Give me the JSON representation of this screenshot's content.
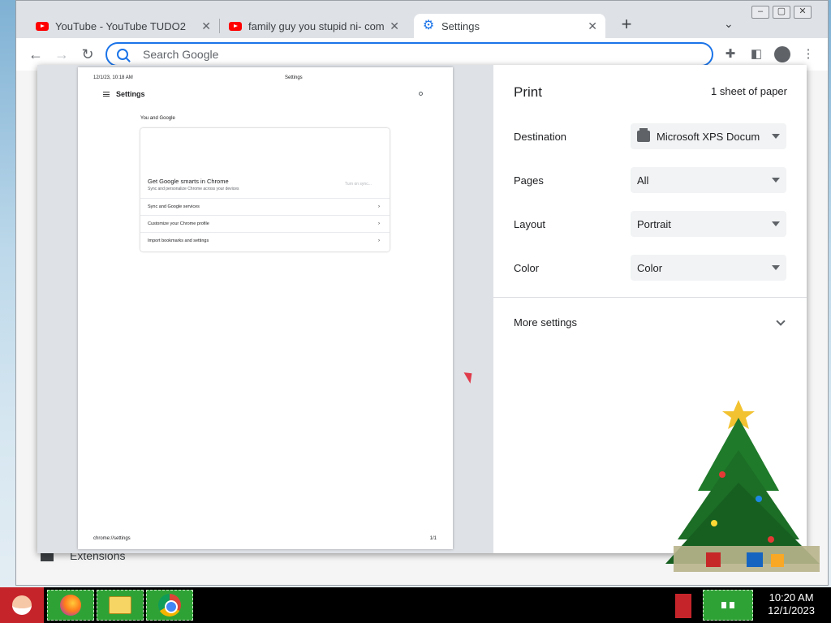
{
  "browser": {
    "tabs": [
      {
        "label": "YouTube - YouTube TUDO2",
        "icon": "youtube-icon",
        "active": false
      },
      {
        "label": "family guy you stupid ni- compila",
        "icon": "youtube-icon",
        "active": false
      },
      {
        "label": "Settings",
        "icon": "gear-icon",
        "active": true
      }
    ],
    "omnibox": {
      "placeholder": "Search Google",
      "value": ""
    }
  },
  "behind_page": {
    "extensions_label": "Extensions"
  },
  "print_preview": {
    "header_left": "12/1/23, 10:18 AM",
    "header_center": "Settings",
    "page_title": "Settings",
    "section": "You and Google",
    "card_title": "Get Google smarts in Chrome",
    "card_subtitle": "Sync and personalize Chrome across your devices",
    "card_button": "Turn on sync...",
    "rows": [
      "Sync and Google services",
      "Customize your Chrome profile",
      "Import bookmarks and settings"
    ],
    "footer_left": "chrome://settings",
    "footer_right": "1/1"
  },
  "print_settings": {
    "title": "Print",
    "sheets": "1 sheet of paper",
    "destination_label": "Destination",
    "destination_value": "Microsoft XPS Docum",
    "pages_label": "Pages",
    "pages_value": "All",
    "layout_label": "Layout",
    "layout_value": "Portrait",
    "color_label": "Color",
    "color_value": "Color",
    "more_settings": "More settings"
  },
  "taskbar": {
    "time": "10:20 AM",
    "date": "12/1/2023"
  },
  "colors": {
    "accent": "#1a73e8",
    "taskbar_green": "#2fa236"
  }
}
